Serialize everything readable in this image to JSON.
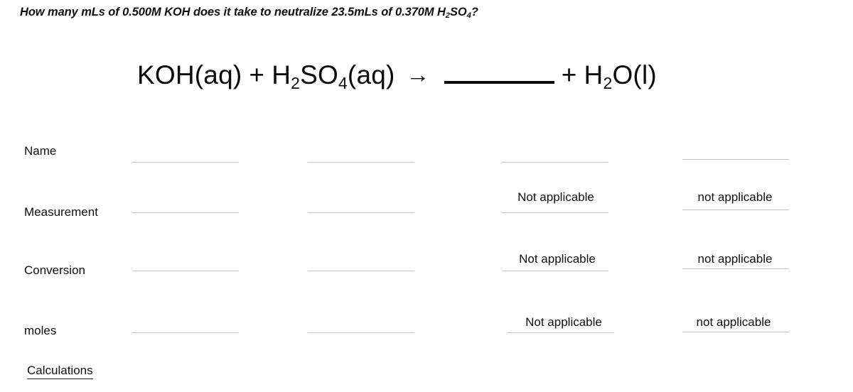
{
  "worksheet": {
    "question": {
      "prefix": "How many mLs of 0.500M KOH does it take to neutralize 23.5mLs of 0.370M H",
      "sub1": "2",
      "mid": "SO",
      "sub2": "4",
      "suffix": "?"
    },
    "equation": {
      "reactant1": "KOH(aq)",
      "plus1": "+",
      "reactant2_a": "H",
      "reactant2_sub1": "2",
      "reactant2_b": "SO",
      "reactant2_sub2": "4",
      "reactant2_c": "(aq)",
      "arrow": "→",
      "product_blank": "",
      "plus2": "+",
      "product2_a": "H",
      "product2_sub": "2",
      "product2_b": "O(l)"
    },
    "rows": [
      {
        "label": "Name",
        "cells": [
          {
            "value": "",
            "blank": true
          },
          {
            "value": "",
            "blank": true
          },
          {
            "value": "",
            "blank": true
          },
          {
            "value": "",
            "blank": true
          }
        ]
      },
      {
        "label": "Measurement",
        "cells": [
          {
            "value": "",
            "blank": true
          },
          {
            "value": "",
            "blank": true
          },
          {
            "value": "Not applicable",
            "blank": true
          },
          {
            "value": "not applicable",
            "blank": true
          }
        ]
      },
      {
        "label": "Conversion",
        "cells": [
          {
            "value": "",
            "blank": true
          },
          {
            "value": "",
            "blank": true
          },
          {
            "value": "Not applicable",
            "blank": true
          },
          {
            "value": "not applicable",
            "blank": true
          }
        ]
      },
      {
        "label": "moles",
        "cells": [
          {
            "value": "",
            "blank": true
          },
          {
            "value": "",
            "blank": true
          },
          {
            "value": "Not applicable",
            "blank": true
          },
          {
            "value": "not applicable",
            "blank": true
          }
        ]
      }
    ],
    "calculations_label": "Calculations",
    "colors": {
      "blank_line": "#b9c5ce",
      "text": "#0d0d0d",
      "equation_blank_line": "#0a0a0a"
    }
  }
}
